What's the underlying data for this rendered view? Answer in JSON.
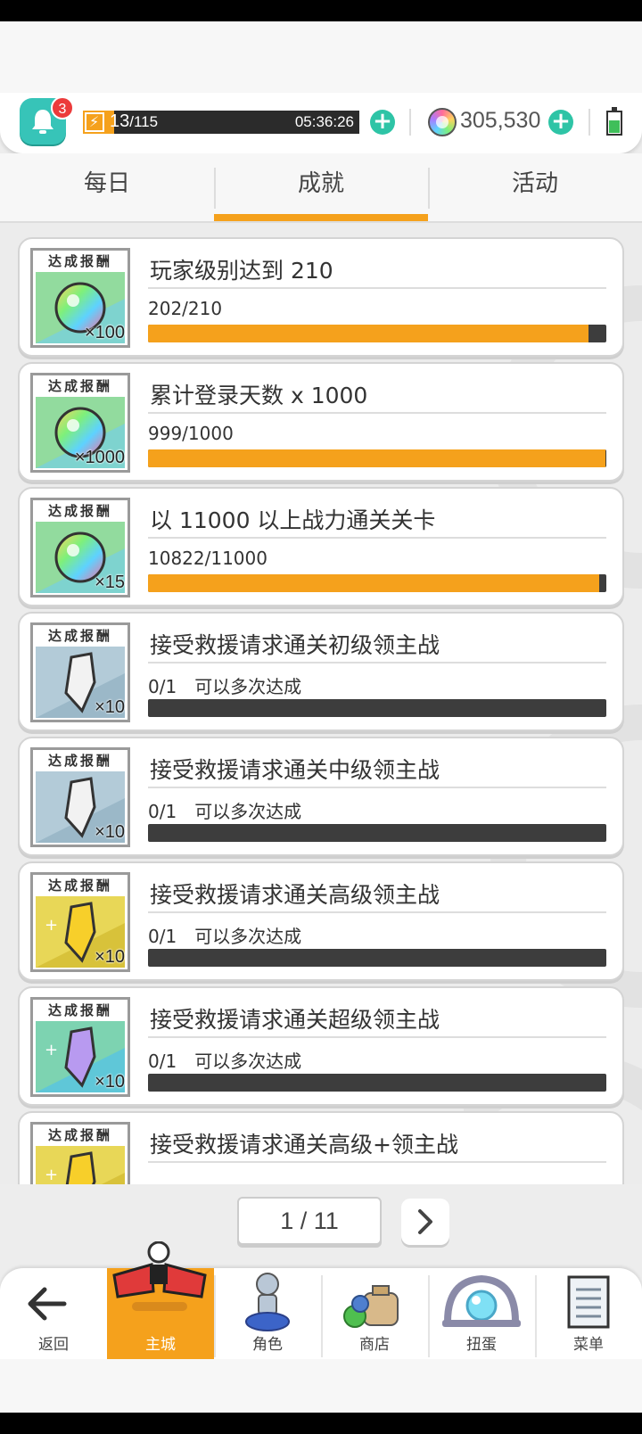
{
  "resources": {
    "notifications": "3",
    "energy_current": "13",
    "energy_max": "/115",
    "energy_fraction": 0.113,
    "energy_timer": "05:36:26",
    "gems": "305,530"
  },
  "tabs": [
    {
      "label": "每日"
    },
    {
      "label": "成就"
    },
    {
      "label": "活动"
    }
  ],
  "reward_header": "达成报酬",
  "achievements": [
    {
      "title": "玩家级别达到 210",
      "progress": "202/210",
      "note": "",
      "fraction": 0.962,
      "reward_count": "×100",
      "reward_icon": "rainbow-gem-icon"
    },
    {
      "title": "累计登录天数  x 1000",
      "progress": "999/1000",
      "note": "",
      "fraction": 0.999,
      "reward_count": "×1000",
      "reward_icon": "rainbow-gem-icon"
    },
    {
      "title": "以 11000 以上战力通关关卡",
      "progress": "10822/11000",
      "note": "",
      "fraction": 0.984,
      "reward_count": "×15",
      "reward_icon": "rainbow-gem-icon"
    },
    {
      "title": "接受救援请求通关初级领主战",
      "progress": "0/1",
      "note": "可以多次达成",
      "fraction": 0,
      "reward_count": "×10",
      "reward_icon": "white-crystal-icon"
    },
    {
      "title": "接受救援请求通关中级领主战",
      "progress": "0/1",
      "note": "可以多次达成",
      "fraction": 0,
      "reward_count": "×10",
      "reward_icon": "white-crystal-icon"
    },
    {
      "title": "接受救援请求通关高级领主战",
      "progress": "0/1",
      "note": "可以多次达成",
      "fraction": 0,
      "reward_count": "×10",
      "reward_icon": "gold-crystal-icon"
    },
    {
      "title": "接受救援请求通关超级领主战",
      "progress": "0/1",
      "note": "可以多次达成",
      "fraction": 0,
      "reward_count": "×10",
      "reward_icon": "purple-crystal-icon"
    },
    {
      "title": "接受救援请求通关高级+领主战",
      "progress": "",
      "note": "",
      "fraction": 0,
      "reward_count": "",
      "reward_icon": "gold-crystal-icon"
    }
  ],
  "pager": {
    "label": "1 / 11"
  },
  "nav": [
    {
      "label": "返回",
      "icon": "back-arrow-icon"
    },
    {
      "label": "主城",
      "icon": "castle-icon"
    },
    {
      "label": "角色",
      "icon": "character-icon"
    },
    {
      "label": "商店",
      "icon": "shop-bag-icon"
    },
    {
      "label": "扭蛋",
      "icon": "gacha-icon"
    },
    {
      "label": "菜单",
      "icon": "menu-list-icon"
    }
  ],
  "colors": {
    "accent": "#f5a11c",
    "bar_bg": "#3d3d3d",
    "teal": "#37c4b8"
  }
}
